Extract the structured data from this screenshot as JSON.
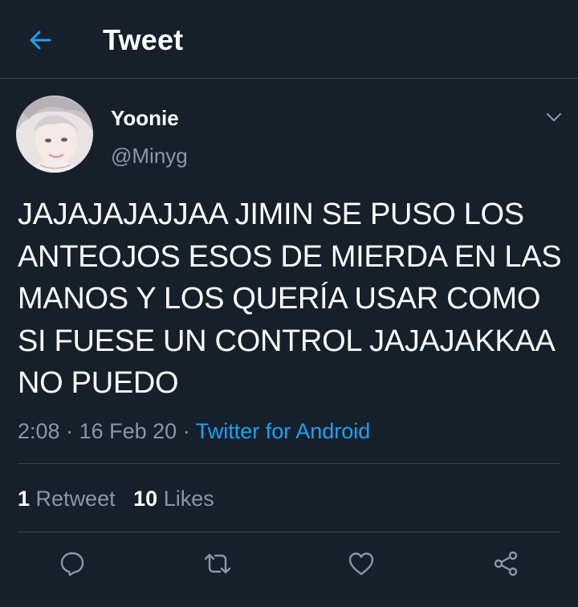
{
  "header": {
    "back_icon": "arrow-left-icon",
    "title": "Tweet"
  },
  "tweet": {
    "author": {
      "display_name": "Yoonie",
      "handle": "@Minyg"
    },
    "text": "JAJAJAJAJJAA JIMIN SE PUSO LOS ANTEOJOS ESOS DE MIERDA EN LAS MANOS Y LOS QUERÍA USAR COMO SI FUESE UN CONTROL JAJAJAKKAA NO PUEDO",
    "time": "2:08",
    "date": "16 Feb 20",
    "separator": "·",
    "source": "Twitter for Android",
    "retweet_count": "1",
    "retweet_label": "Retweet",
    "like_count": "10",
    "like_label": "Likes"
  },
  "actions": [
    "reply-icon",
    "retweet-icon",
    "like-icon",
    "share-icon"
  ],
  "colors": {
    "background": "#15202b",
    "accent": "#1da1f2",
    "secondary_text": "#8899a6",
    "divider": "#38444d"
  }
}
